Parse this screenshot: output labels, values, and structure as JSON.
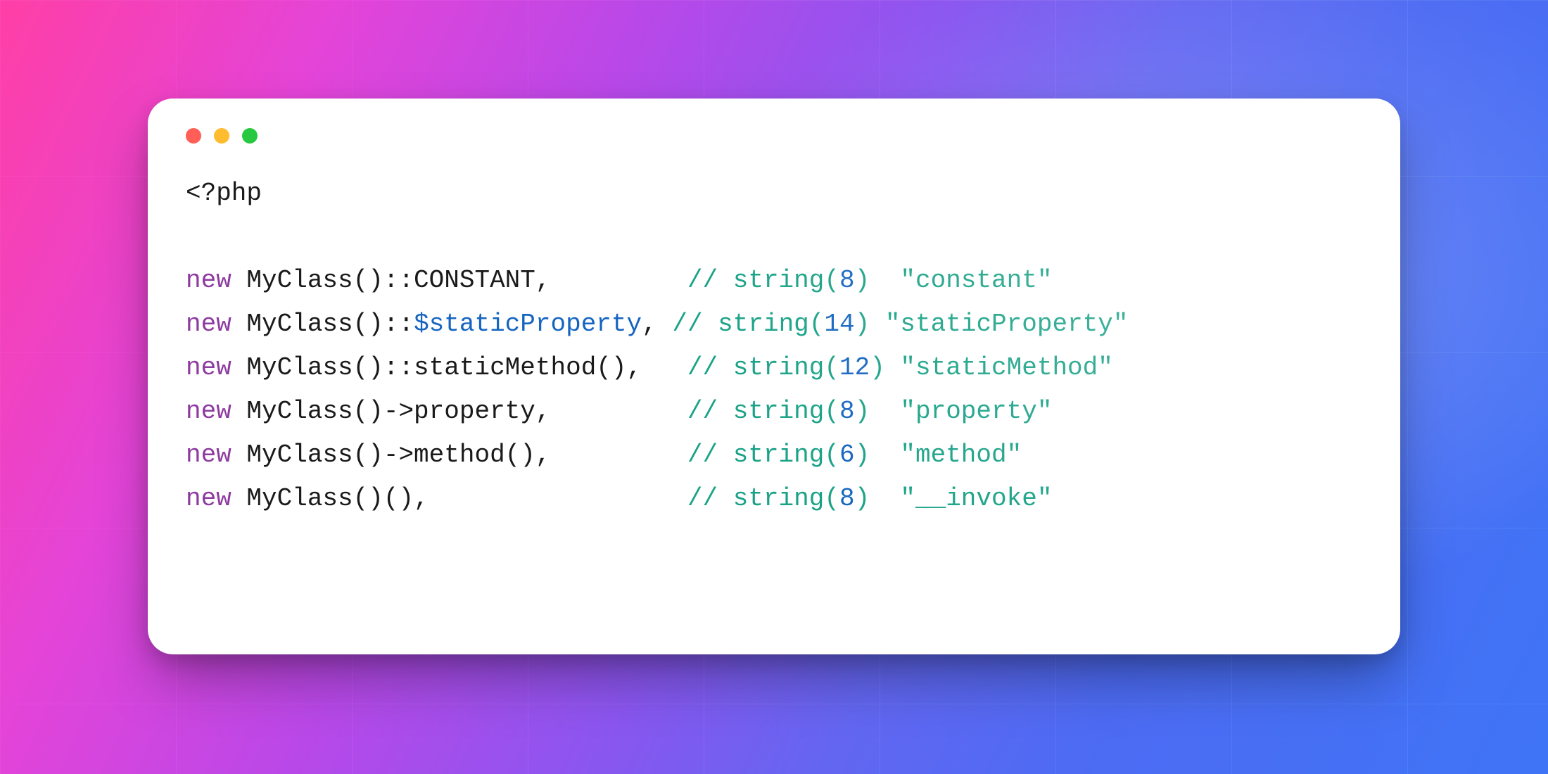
{
  "opening_tag": "<?php",
  "lines": [
    {
      "kw": "new",
      "code_rest": " MyClass()::CONSTANT,         ",
      "var": "",
      "after_var": "",
      "comment_prefix": "// ",
      "type_word": "string",
      "paren_open": "(",
      "len": "8",
      "paren_close": ")  ",
      "value": "\"constant\""
    },
    {
      "kw": "new",
      "code_rest": " MyClass()::",
      "var": "$staticProperty",
      "after_var": ", ",
      "comment_prefix": "// ",
      "type_word": "string",
      "paren_open": "(",
      "len": "14",
      "paren_close": ") ",
      "value": "\"staticProperty\""
    },
    {
      "kw": "new",
      "code_rest": " MyClass()::staticMethod(),   ",
      "var": "",
      "after_var": "",
      "comment_prefix": "// ",
      "type_word": "string",
      "paren_open": "(",
      "len": "12",
      "paren_close": ") ",
      "value": "\"staticMethod\""
    },
    {
      "kw": "new",
      "code_rest": " MyClass()->property,         ",
      "var": "",
      "after_var": "",
      "comment_prefix": "// ",
      "type_word": "string",
      "paren_open": "(",
      "len": "8",
      "paren_close": ")  ",
      "value": "\"property\""
    },
    {
      "kw": "new",
      "code_rest": " MyClass()->method(),         ",
      "var": "",
      "after_var": "",
      "comment_prefix": "// ",
      "type_word": "string",
      "paren_open": "(",
      "len": "6",
      "paren_close": ")  ",
      "value": "\"method\""
    },
    {
      "kw": "new",
      "code_rest": " MyClass()(),                 ",
      "var": "",
      "after_var": "",
      "comment_prefix": "// ",
      "type_word": "string",
      "paren_open": "(",
      "len": "8",
      "paren_close": ")  ",
      "value": "\"__invoke\""
    }
  ]
}
